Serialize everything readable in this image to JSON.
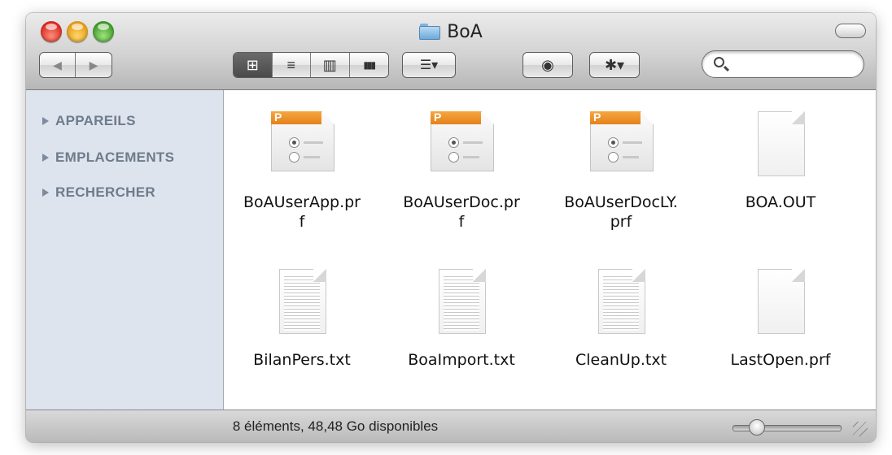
{
  "window": {
    "title": "BoA",
    "controls": [
      "close",
      "minimize",
      "zoom"
    ]
  },
  "toolbar": {
    "back_glyph": "◀",
    "forward_glyph": "▶",
    "view_modes": [
      {
        "name": "icon-view",
        "glyph": "⊞",
        "active": true
      },
      {
        "name": "list-view",
        "glyph": "≡",
        "active": false
      },
      {
        "name": "column-view",
        "glyph": "▥",
        "active": false
      },
      {
        "name": "coverflow-view",
        "glyph": "▮▮▮",
        "active": false
      }
    ],
    "arrange_glyph": "☰▾",
    "quicklook_glyph": "◉",
    "action_glyph": "✱▾",
    "search": {
      "placeholder": "",
      "value": ""
    }
  },
  "sidebar": {
    "items": [
      {
        "label": "APPAREILS"
      },
      {
        "label": "EMPLACEMENTS"
      },
      {
        "label": "RECHERCHER"
      }
    ]
  },
  "files": [
    {
      "name": "BoAUserApp.pr\nf",
      "kind": "prf-icon"
    },
    {
      "name": "BoAUserDoc.pr\nf",
      "kind": "prf-icon"
    },
    {
      "name": "BoAUserDocLY.\nprf",
      "kind": "prf-icon"
    },
    {
      "name": "BOA.OUT",
      "kind": "blank-document-icon"
    },
    {
      "name": "BilanPers.txt",
      "kind": "text-document-icon"
    },
    {
      "name": "BoaImport.txt",
      "kind": "text-document-icon"
    },
    {
      "name": "CleanUp.txt",
      "kind": "text-document-icon"
    },
    {
      "name": "LastOpen.prf",
      "kind": "blank-document-icon"
    }
  ],
  "status": {
    "text": "8 éléments, 48,48 Go disponibles",
    "icon_size": 0.15
  },
  "colors": {
    "sidebar_bg": "#dde4ee",
    "sidebar_text": "#6e7b8b",
    "prf_accent": "#e4821c"
  }
}
